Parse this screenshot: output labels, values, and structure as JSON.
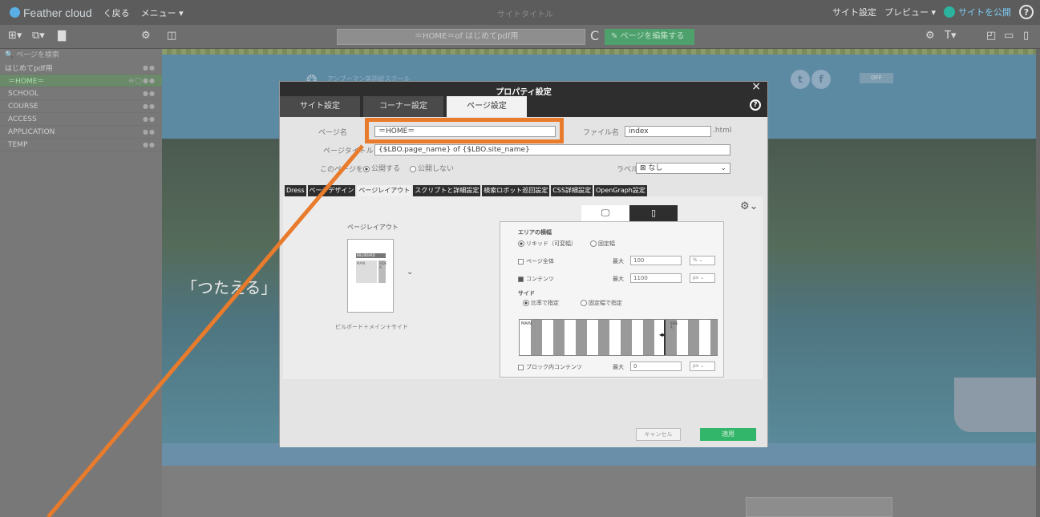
{
  "topbar": {
    "logo": "Feather cloud",
    "back": "く戻る",
    "menu": "メニュー ▾",
    "center_title": "サイトタイトル",
    "site_settings": "サイト設定",
    "preview": "プレビュー ▾",
    "publish": "サイトを公開",
    "help": "?"
  },
  "toolbar2": {
    "url": "＝HOME＝of はじめてpdf用",
    "reload": "C",
    "edit_page": "ページを編集する",
    "text_size": "T",
    "toggle_icons": [
      "gear-icon",
      "text-size-icon",
      "layout-icon",
      "desktop-icon",
      "mobile-icon"
    ]
  },
  "sidebar": {
    "search_placeholder": "ページを検索",
    "root": "はじめてpdf用",
    "items": [
      {
        "label": "＝HOME＝",
        "active": true
      },
      {
        "label": "SCHOOL"
      },
      {
        "label": "COURSE"
      },
      {
        "label": "ACCESS"
      },
      {
        "label": "APPLICATION"
      },
      {
        "label": "TEMP"
      }
    ]
  },
  "site": {
    "brand": "アンブーマン英語総スクール",
    "hero_text": "「つたえる」",
    "sns": [
      "t",
      "f"
    ],
    "off_badge": "OFF"
  },
  "dialog": {
    "title": "プロパティ設定",
    "close": "×",
    "help": "?",
    "tabs": [
      "サイト設定",
      "コーナー設定",
      "ページ設定"
    ],
    "active_tab": 2,
    "page_name_label": "ページ名",
    "page_name_value": "＝HOME＝",
    "file_name_label": "ファイル名",
    "file_name_value": "index",
    "file_ext": ".html",
    "page_title_label": "ページタイトル",
    "page_title_value": "{$LBO.page_name} of {$LBO.site_name}",
    "publish_label": "このページを",
    "publish_on": "公開する",
    "publish_off": "公開しない",
    "label_label": "ラベル",
    "label_value": "なし",
    "sub_tabs": [
      "Dress",
      "ページデザイン",
      "ページレイアウト",
      "スクリプトと詳細設定",
      "検索ロボット巡回設定",
      "CSS詳細設定",
      "OpenGraph設定"
    ],
    "active_sub_tab": 2,
    "layout_title": "ページレイアウト",
    "layout_caption": "ビルボード＋メイン＋サイド",
    "thumb_billboard": "BILLBOARD",
    "thumb_main": "MAIN",
    "thumb_side": "SIDE A",
    "area_width_label": "エリアの横幅",
    "liquid": "リキッド（可変幅）",
    "fixed": "固定幅",
    "page_whole": "ページ全体",
    "max_label": "最大",
    "page_whole_max": "100",
    "page_whole_unit": "%",
    "content": "コンテンツ",
    "content_max": "1100",
    "content_unit": "px",
    "side_label": "サイド",
    "ratio": "比率で指定",
    "fixed_width": "固定幅で指定",
    "stripe_main": "MAIN",
    "stripe_side": "SIDE A",
    "block_content": "ブロック内コンテンツ",
    "block_max": "0",
    "block_unit": "px",
    "cancel": "キャンセル",
    "apply": "適用"
  },
  "colors": {
    "annotation": "#e87b2c",
    "apply": "#32b66a",
    "edit": "#4ea06d"
  }
}
